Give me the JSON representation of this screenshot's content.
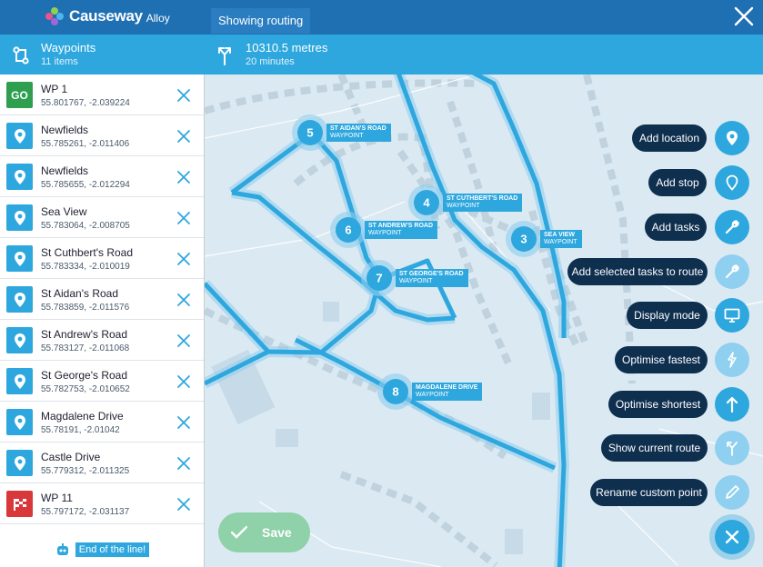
{
  "app": {
    "brand": "Causeway",
    "product": "Alloy",
    "mode": "Showing routing"
  },
  "summary": {
    "waypoints_label": "Waypoints",
    "waypoints_count": "11 items",
    "distance": "10310.5 metres",
    "duration": "20 minutes"
  },
  "waypoints": [
    {
      "badge": "GO",
      "type": "start",
      "name": "WP 1",
      "coords": "55.801767, -2.039224"
    },
    {
      "type": "pin",
      "name": "Newfields",
      "coords": "55.785261, -2.011406"
    },
    {
      "type": "pin",
      "name": "Newfields",
      "coords": "55.785655, -2.012294"
    },
    {
      "type": "pin",
      "name": "Sea View",
      "coords": "55.783064, -2.008705"
    },
    {
      "type": "pin",
      "name": "St Cuthbert's Road",
      "coords": "55.783334, -2.010019"
    },
    {
      "type": "pin",
      "name": "St Aidan's Road",
      "coords": "55.783859, -2.011576"
    },
    {
      "type": "pin",
      "name": "St Andrew's Road",
      "coords": "55.783127, -2.011068"
    },
    {
      "type": "pin",
      "name": "St George's Road",
      "coords": "55.782753, -2.010652"
    },
    {
      "type": "pin",
      "name": "Magdalene Drive",
      "coords": "55.78191, -2.01042"
    },
    {
      "type": "pin",
      "name": "Castle Drive",
      "coords": "55.779312, -2.011325"
    },
    {
      "type": "finish",
      "name": "WP 11",
      "coords": "55.797172, -2.031137"
    }
  ],
  "end_message": "End of the line!",
  "markers": [
    {
      "num": "5",
      "title": "ST AIDAN'S ROAD",
      "type": "WAYPOINT"
    },
    {
      "num": "4",
      "title": "ST CUTHBERT'S ROAD",
      "type": "WAYPOINT"
    },
    {
      "num": "6",
      "title": "ST ANDREW'S ROAD",
      "type": "WAYPOINT"
    },
    {
      "num": "3",
      "title": "SEA VIEW",
      "type": "WAYPOINT"
    },
    {
      "num": "7",
      "title": "ST GEORGE'S ROAD",
      "type": "WAYPOINT"
    },
    {
      "num": "8",
      "title": "MAGDALENE DRIVE",
      "type": "WAYPOINT"
    }
  ],
  "actions": [
    {
      "label": "Add location",
      "icon": "location-pin-icon"
    },
    {
      "label": "Add stop",
      "icon": "map-pin-outline-icon"
    },
    {
      "label": "Add tasks",
      "icon": "wrench-icon"
    },
    {
      "label": "Add selected tasks to route",
      "icon": "wrench-icon"
    },
    {
      "label": "Display mode",
      "icon": "monitor-icon"
    },
    {
      "label": "Optimise fastest",
      "icon": "lightning-icon"
    },
    {
      "label": "Optimise shortest",
      "icon": "arrow-up-icon"
    },
    {
      "label": "Show current route",
      "icon": "route-merge-icon"
    },
    {
      "label": "Rename custom point",
      "icon": "pencil-icon"
    }
  ],
  "save_label": "Save",
  "colors": {
    "topbar": "#1f6fb3",
    "infobar": "#2ea7de",
    "route": "#2ea7de",
    "action_pill": "#0f2f4f",
    "go": "#2e9e4f",
    "finish": "#d9383b"
  }
}
